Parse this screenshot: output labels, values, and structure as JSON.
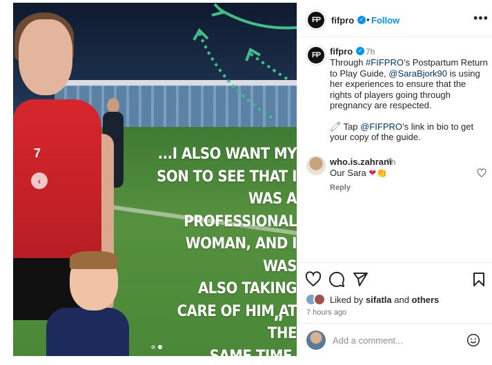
{
  "post": {
    "account": "fifpro",
    "avatar_text": "FP",
    "follow_label": "Follow",
    "separator": "•",
    "more_label": "•••"
  },
  "media": {
    "quote_lines": [
      "...I also want my",
      "son to see that I",
      "was a",
      "professional",
      "woman, and I was",
      "also taking",
      "care of him at the",
      "same time."
    ],
    "quote_mark": "\"",
    "jersey_number": "7",
    "prev_label": "‹",
    "slide_count": 2,
    "active_slide": 2
  },
  "caption": {
    "username": "fifpro",
    "time": "7h",
    "line1_a": "Through ",
    "hashtag": "#FIFPRO",
    "line1_b": "’s Postpartum Return to Play Guide, ",
    "mention": "@SaraBjork90",
    "line1_c": " is using her experiences to ensure that the rights of players going through pregnancy are respected.",
    "line2_emoji": "🧷",
    "line2_a": " Tap ",
    "mention2": "@FIFPRO",
    "line2_b": "’s link in bio to get your copy of the guide."
  },
  "comment": {
    "username": "who.is.zahrani",
    "time": "7h",
    "text": "Our Sara",
    "emoji_heart": "❤",
    "emoji_clap": "👏",
    "reply_label": "Reply"
  },
  "actions": {
    "liked_prefix": "Liked by ",
    "liked_user": "sifatla",
    "liked_and": " and ",
    "liked_others": "others",
    "post_time": "7 hours ago"
  },
  "add_comment": {
    "placeholder": "Add a comment..."
  },
  "colors": {
    "accent": "#0095f6",
    "link": "#00376b",
    "muted": "#737373",
    "heart": "#e0245e"
  }
}
